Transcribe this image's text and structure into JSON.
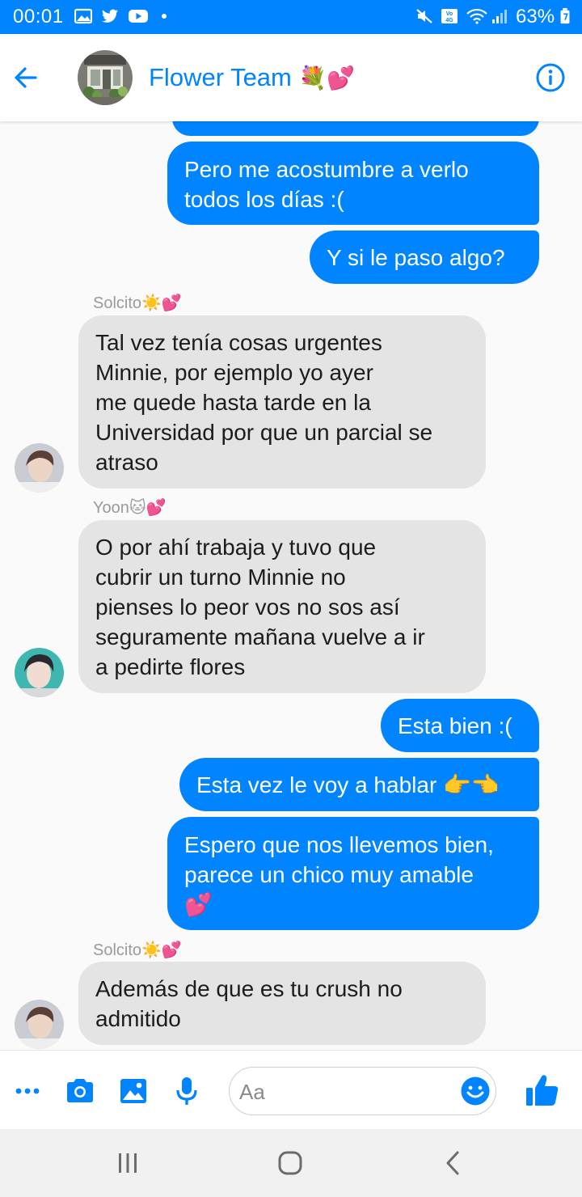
{
  "status_bar": {
    "time": "00:01",
    "battery": "63%",
    "icons": [
      "gallery-icon",
      "twitter-icon",
      "youtube-icon",
      "mute-icon",
      "volte-icon",
      "wifi-icon",
      "signal-icon",
      "battery-icon"
    ]
  },
  "header": {
    "title": "Flower Team",
    "title_emoji": "💐💕",
    "icons": [
      "back-arrow-icon",
      "group-avatar",
      "info-icon"
    ]
  },
  "messages": [
    {
      "direction": "out",
      "text": ""
    },
    {
      "direction": "out",
      "text": "Pero me acostumbre a verlo\ntodos los días :("
    },
    {
      "direction": "out",
      "text": "Y si le paso algo?"
    },
    {
      "direction": "in",
      "sender": "Solcito☀️💕",
      "text": "Tal vez tenía cosas urgentes\nMinnie, por ejemplo yo ayer\nme quede hasta tarde en la\nUniversidad por que un parcial se\natraso"
    },
    {
      "direction": "in",
      "sender": "Yoon🐱💕",
      "text": "O por ahí trabaja y tuvo que\ncubrir un turno Minnie no\npienses lo peor vos no sos así\nseguramente mañana vuelve a ir\na pedirte flores"
    },
    {
      "direction": "out",
      "text": "Esta bien :("
    },
    {
      "direction": "out",
      "text": "Esta vez le voy a hablar 👉👈"
    },
    {
      "direction": "out",
      "text": "Espero que nos llevemos bien,\nparece un chico muy amable\n💕"
    },
    {
      "direction": "in",
      "sender": "Solcito☀️💕",
      "text": "Además de que es tu crush no\nadmitido"
    }
  ],
  "composer": {
    "placeholder": "Aa",
    "icons": [
      "more-icon",
      "camera-icon",
      "image-icon",
      "microphone-icon",
      "emoji-icon",
      "thumbs-up-icon"
    ]
  },
  "nav_bar": {
    "icons": [
      "recent-apps-icon",
      "home-icon",
      "back-icon"
    ]
  },
  "colors": {
    "accent": "#0084ff",
    "incoming_bubble": "#e4e4e4",
    "background": "#fafafa"
  }
}
